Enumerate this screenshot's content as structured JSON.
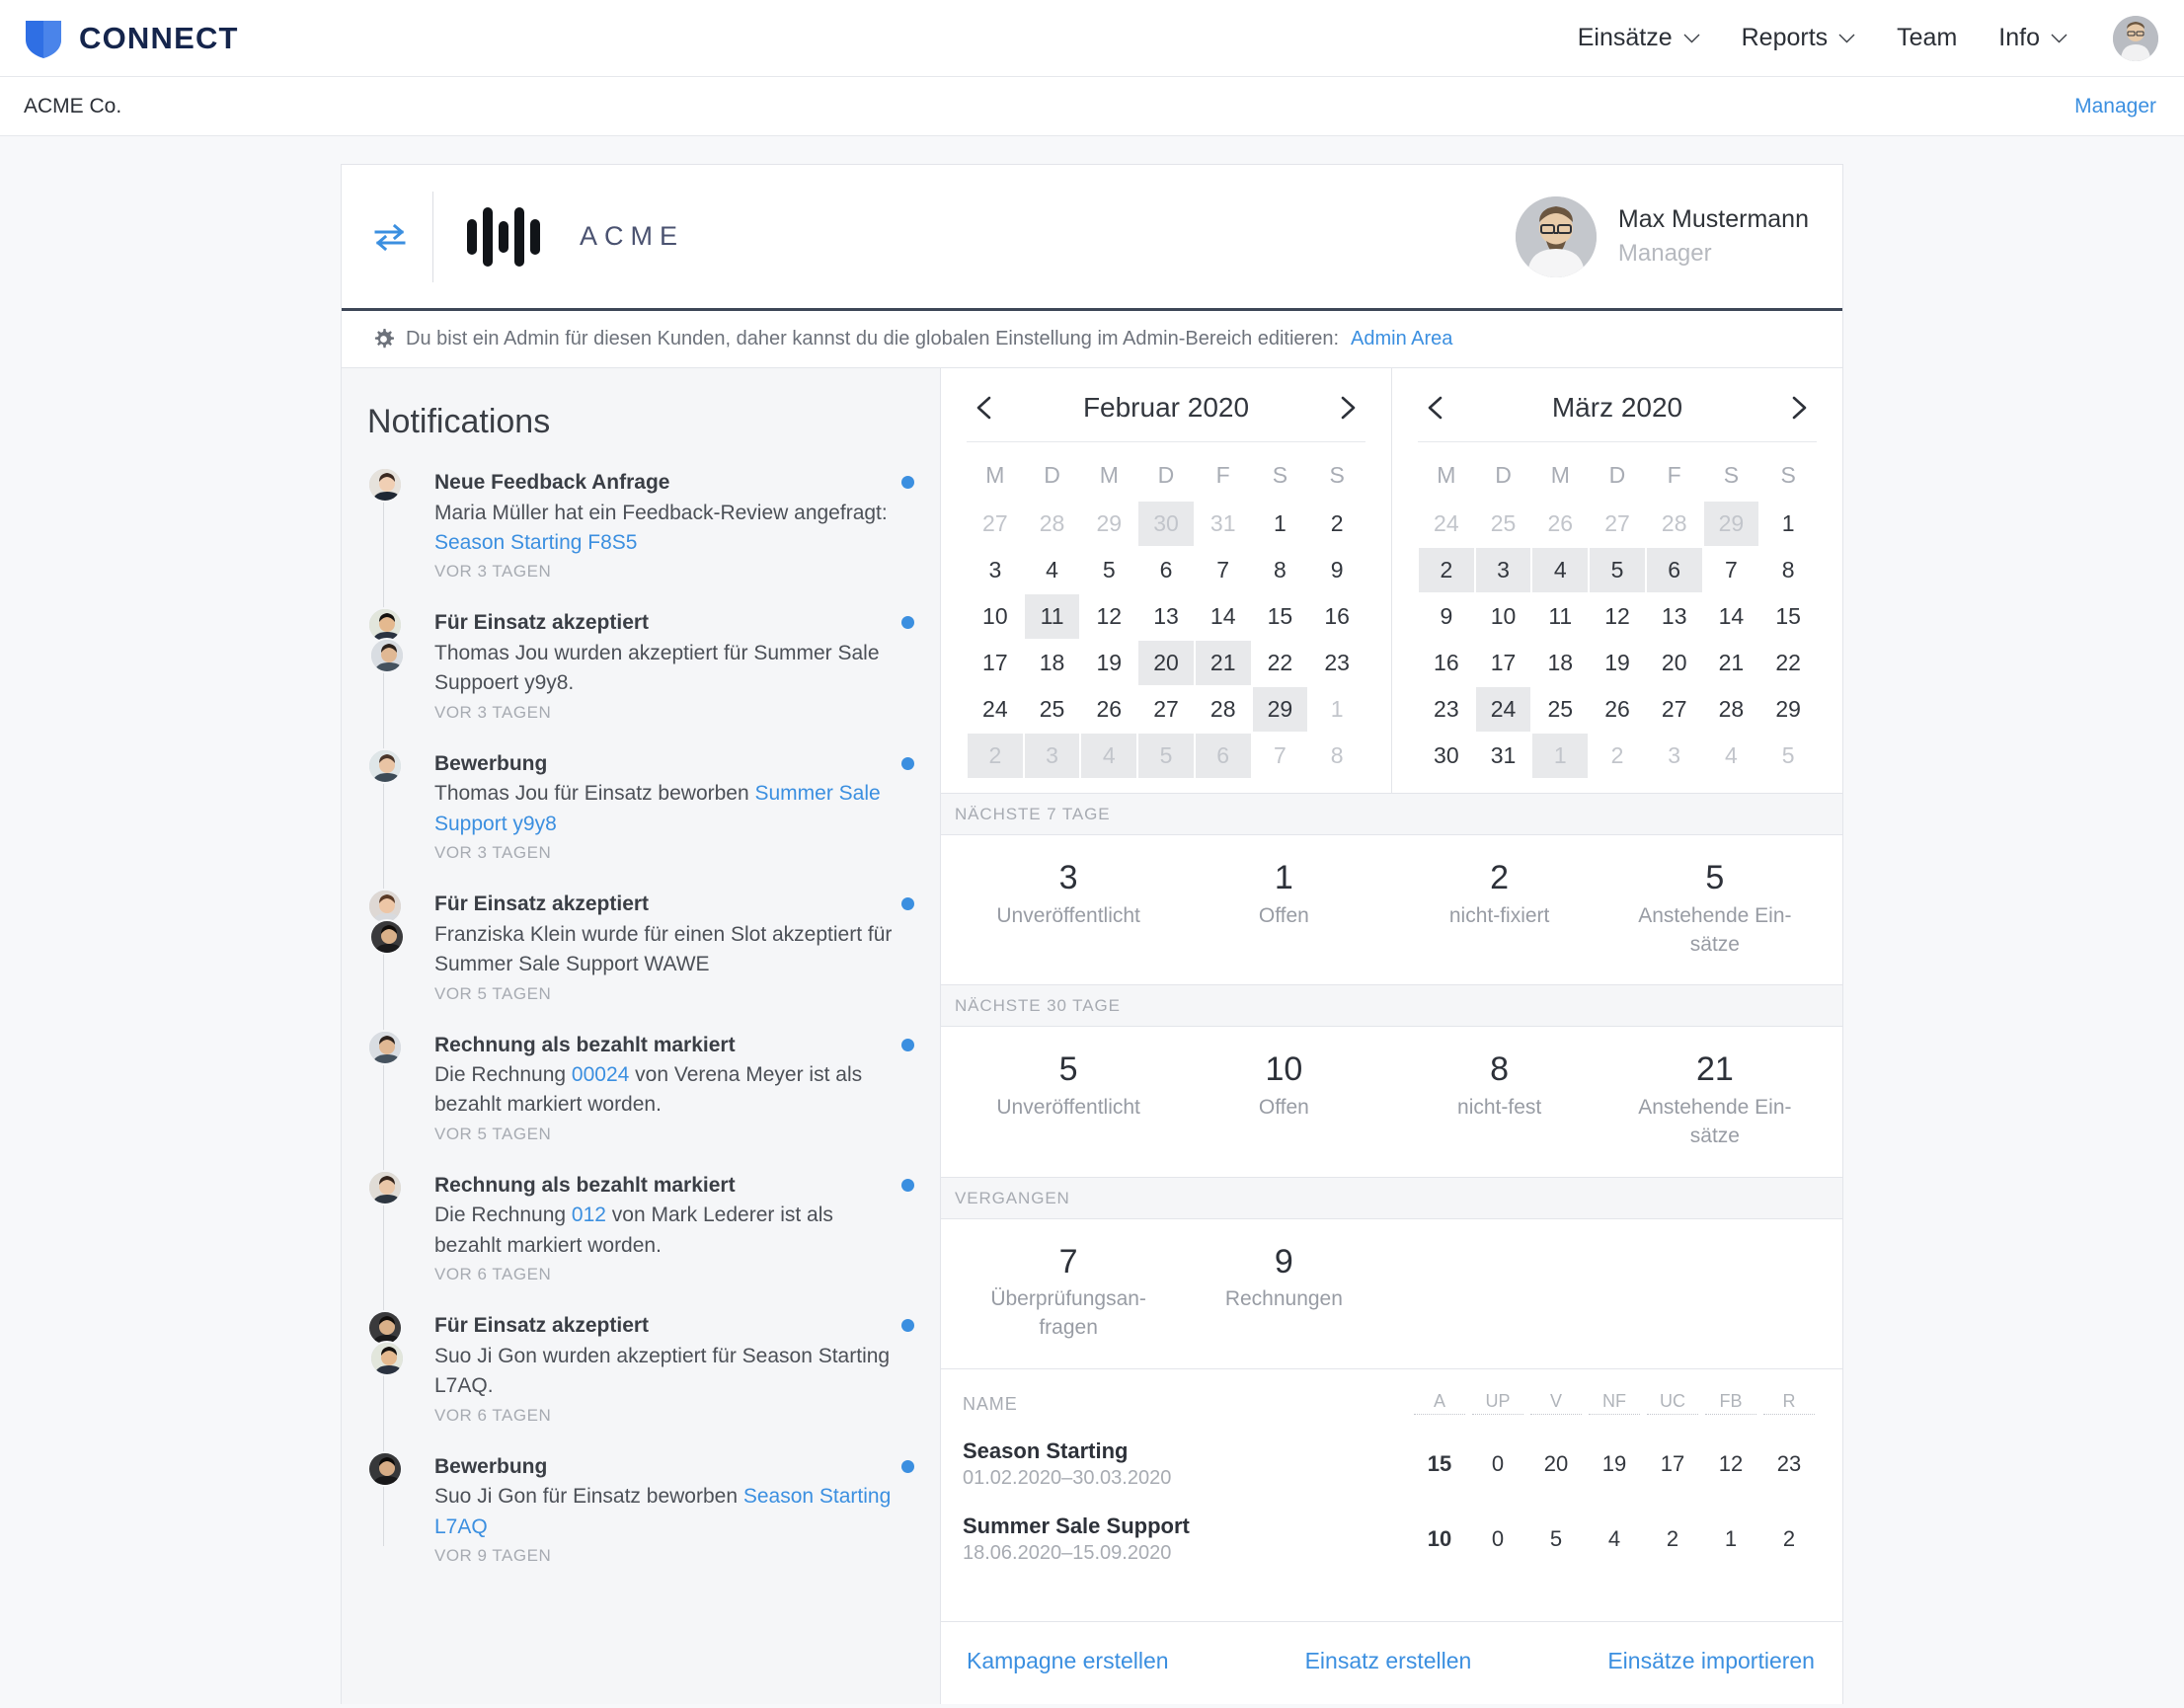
{
  "colors": {
    "accent": "#3b8fe0",
    "brand_navy": "#15254c",
    "shield": "#2f6fe4"
  },
  "topnav": {
    "brand": "CONNECT",
    "items": [
      {
        "label": "Einsätze",
        "has_caret": true
      },
      {
        "label": "Reports",
        "has_caret": true
      },
      {
        "label": "Team",
        "has_caret": false
      },
      {
        "label": "Info",
        "has_caret": true
      }
    ]
  },
  "subheader": {
    "customer": "ACME Co.",
    "role_link": "Manager"
  },
  "card_header": {
    "company": "ACME",
    "user_name": "Max Mustermann",
    "user_role": "Manager"
  },
  "admin_notice": {
    "text": "Du bist ein Admin für diesen Kunden, daher kannst du die globalen Einstellung im Admin-Bereich editieren:",
    "link": "Admin Area"
  },
  "notifications": {
    "title": "Notifications",
    "items": [
      {
        "title": "Neue Feedback Anfrage",
        "text_before": "Maria Müller hat ein Feedback-Review angefragt: ",
        "link": "Season Starting F8S5",
        "text_after": "",
        "time": "VOR 3 TAGEN",
        "avatars": 1,
        "unread": true
      },
      {
        "title": "Für Einsatz akzeptiert",
        "text_before": "Thomas Jou wurden akzeptiert für Summer Sale Suppoert y9y8.",
        "link": "",
        "text_after": "",
        "time": "VOR 3 TAGEN",
        "avatars": 2,
        "unread": true
      },
      {
        "title": "Bewerbung",
        "text_before": "Thomas Jou für Einsatz beworben ",
        "link": "Summer Sale Support y9y8",
        "text_after": "",
        "time": "VOR 3 TAGEN",
        "avatars": 1,
        "unread": true
      },
      {
        "title": "Für Einsatz akzeptiert",
        "text_before": "Franziska Klein wurde für einen Slot akzeptiert für Summer Sale Support WAWE",
        "link": "",
        "text_after": "",
        "time": "VOR 5 TAGEN",
        "avatars": 2,
        "unread": true
      },
      {
        "title": "Rechnung als bezahlt markiert",
        "text_before": "Die Rechnung ",
        "link": "00024",
        "text_after": " von Verena Meyer ist als bezahlt markiert worden.",
        "time": "VOR 5 TAGEN",
        "avatars": 1,
        "unread": true
      },
      {
        "title": "Rechnung als bezahlt markiert",
        "text_before": "Die Rechnung ",
        "link": "012",
        "text_after": " von Mark Lederer ist als bezahlt markiert worden.",
        "time": "VOR 6 TAGEN",
        "avatars": 1,
        "unread": true
      },
      {
        "title": "Für Einsatz akzeptiert",
        "text_before": "Suo Ji Gon wurden akzeptiert für Season Starting L7AQ.",
        "link": "",
        "text_after": "",
        "time": "VOR 6 TAGEN",
        "avatars": 2,
        "unread": true
      },
      {
        "title": "Bewerbung",
        "text_before": "Suo Ji Gon für Einsatz beworben ",
        "link": "Season Starting L7AQ",
        "text_after": "",
        "time": "VOR 9 TAGEN",
        "avatars": 1,
        "unread": true
      }
    ]
  },
  "calendars": [
    {
      "month_label": "Februar 2020",
      "dow": [
        "M",
        "D",
        "M",
        "D",
        "F",
        "S",
        "S"
      ],
      "days": [
        {
          "n": 27,
          "mute": true,
          "hl": false
        },
        {
          "n": 28,
          "mute": true,
          "hl": false
        },
        {
          "n": 29,
          "mute": true,
          "hl": false
        },
        {
          "n": 30,
          "mute": true,
          "hl": true
        },
        {
          "n": 31,
          "mute": true,
          "hl": false
        },
        {
          "n": 1,
          "mute": false,
          "hl": false
        },
        {
          "n": 2,
          "mute": false,
          "hl": false
        },
        {
          "n": 3,
          "mute": false,
          "hl": false
        },
        {
          "n": 4,
          "mute": false,
          "hl": false
        },
        {
          "n": 5,
          "mute": false,
          "hl": false
        },
        {
          "n": 6,
          "mute": false,
          "hl": false
        },
        {
          "n": 7,
          "mute": false,
          "hl": false
        },
        {
          "n": 8,
          "mute": false,
          "hl": false
        },
        {
          "n": 9,
          "mute": false,
          "hl": false
        },
        {
          "n": 10,
          "mute": false,
          "hl": false
        },
        {
          "n": 11,
          "mute": false,
          "hl": true
        },
        {
          "n": 12,
          "mute": false,
          "hl": false
        },
        {
          "n": 13,
          "mute": false,
          "hl": false
        },
        {
          "n": 14,
          "mute": false,
          "hl": false
        },
        {
          "n": 15,
          "mute": false,
          "hl": false
        },
        {
          "n": 16,
          "mute": false,
          "hl": false
        },
        {
          "n": 17,
          "mute": false,
          "hl": false
        },
        {
          "n": 18,
          "mute": false,
          "hl": false
        },
        {
          "n": 19,
          "mute": false,
          "hl": false
        },
        {
          "n": 20,
          "mute": false,
          "hl": true
        },
        {
          "n": 21,
          "mute": false,
          "hl": true
        },
        {
          "n": 22,
          "mute": false,
          "hl": false
        },
        {
          "n": 23,
          "mute": false,
          "hl": false
        },
        {
          "n": 24,
          "mute": false,
          "hl": false
        },
        {
          "n": 25,
          "mute": false,
          "hl": false
        },
        {
          "n": 26,
          "mute": false,
          "hl": false
        },
        {
          "n": 27,
          "mute": false,
          "hl": false
        },
        {
          "n": 28,
          "mute": false,
          "hl": false
        },
        {
          "n": 29,
          "mute": false,
          "hl": true
        },
        {
          "n": 1,
          "mute": true,
          "hl": false
        },
        {
          "n": 2,
          "mute": true,
          "hl": true
        },
        {
          "n": 3,
          "mute": true,
          "hl": true
        },
        {
          "n": 4,
          "mute": true,
          "hl": true
        },
        {
          "n": 5,
          "mute": true,
          "hl": true
        },
        {
          "n": 6,
          "mute": true,
          "hl": true
        },
        {
          "n": 7,
          "mute": true,
          "hl": false
        },
        {
          "n": 8,
          "mute": true,
          "hl": false
        }
      ]
    },
    {
      "month_label": "März 2020",
      "dow": [
        "M",
        "D",
        "M",
        "D",
        "F",
        "S",
        "S"
      ],
      "days": [
        {
          "n": 24,
          "mute": true,
          "hl": false
        },
        {
          "n": 25,
          "mute": true,
          "hl": false
        },
        {
          "n": 26,
          "mute": true,
          "hl": false
        },
        {
          "n": 27,
          "mute": true,
          "hl": false
        },
        {
          "n": 28,
          "mute": true,
          "hl": false
        },
        {
          "n": 29,
          "mute": true,
          "hl": true
        },
        {
          "n": 1,
          "mute": false,
          "hl": false
        },
        {
          "n": 2,
          "mute": false,
          "hl": true
        },
        {
          "n": 3,
          "mute": false,
          "hl": true
        },
        {
          "n": 4,
          "mute": false,
          "hl": true
        },
        {
          "n": 5,
          "mute": false,
          "hl": true
        },
        {
          "n": 6,
          "mute": false,
          "hl": true
        },
        {
          "n": 7,
          "mute": false,
          "hl": false
        },
        {
          "n": 8,
          "mute": false,
          "hl": false
        },
        {
          "n": 9,
          "mute": false,
          "hl": false
        },
        {
          "n": 10,
          "mute": false,
          "hl": false
        },
        {
          "n": 11,
          "mute": false,
          "hl": false
        },
        {
          "n": 12,
          "mute": false,
          "hl": false
        },
        {
          "n": 13,
          "mute": false,
          "hl": false
        },
        {
          "n": 14,
          "mute": false,
          "hl": false
        },
        {
          "n": 15,
          "mute": false,
          "hl": false
        },
        {
          "n": 16,
          "mute": false,
          "hl": false
        },
        {
          "n": 17,
          "mute": false,
          "hl": false
        },
        {
          "n": 18,
          "mute": false,
          "hl": false
        },
        {
          "n": 19,
          "mute": false,
          "hl": false
        },
        {
          "n": 20,
          "mute": false,
          "hl": false
        },
        {
          "n": 21,
          "mute": false,
          "hl": false
        },
        {
          "n": 22,
          "mute": false,
          "hl": false
        },
        {
          "n": 23,
          "mute": false,
          "hl": false
        },
        {
          "n": 24,
          "mute": false,
          "hl": true
        },
        {
          "n": 25,
          "mute": false,
          "hl": false
        },
        {
          "n": 26,
          "mute": false,
          "hl": false
        },
        {
          "n": 27,
          "mute": false,
          "hl": false
        },
        {
          "n": 28,
          "mute": false,
          "hl": false
        },
        {
          "n": 29,
          "mute": false,
          "hl": false
        },
        {
          "n": 30,
          "mute": false,
          "hl": false
        },
        {
          "n": 31,
          "mute": false,
          "hl": false
        },
        {
          "n": 1,
          "mute": true,
          "hl": true
        },
        {
          "n": 2,
          "mute": true,
          "hl": false
        },
        {
          "n": 3,
          "mute": true,
          "hl": false
        },
        {
          "n": 4,
          "mute": true,
          "hl": false
        },
        {
          "n": 5,
          "mute": true,
          "hl": false
        }
      ]
    }
  ],
  "stat_groups": [
    {
      "label": "NÄCHSTE 7 TAGE",
      "stats": [
        {
          "value": "3",
          "caption": "Unveröffentlicht"
        },
        {
          "value": "1",
          "caption": "Offen"
        },
        {
          "value": "2",
          "caption": "nicht-fixiert"
        },
        {
          "value": "5",
          "caption": "Anstehende Ein-sätze"
        }
      ]
    },
    {
      "label": "NÄCHSTE 30 TAGE",
      "stats": [
        {
          "value": "5",
          "caption": "Unveröffentlicht"
        },
        {
          "value": "10",
          "caption": "Offen"
        },
        {
          "value": "8",
          "caption": "nicht-fest"
        },
        {
          "value": "21",
          "caption": "Anstehende Ein-sätze"
        }
      ]
    },
    {
      "label": "VERGANGEN",
      "stats": [
        {
          "value": "7",
          "caption": "Überprüfungsan-fragen"
        },
        {
          "value": "9",
          "caption": "Rechnungen"
        },
        {
          "value": "",
          "caption": ""
        },
        {
          "value": "",
          "caption": ""
        }
      ]
    }
  ],
  "campaigns": {
    "name_header": "NAME",
    "metric_headers": [
      "A",
      "UP",
      "V",
      "NF",
      "UC",
      "FB",
      "R"
    ],
    "rows": [
      {
        "name": "Season Starting",
        "dates": "01.02.2020–30.03.2020",
        "values": [
          "15",
          "0",
          "20",
          "19",
          "17",
          "12",
          "23"
        ]
      },
      {
        "name": "Summer Sale Support",
        "dates": "18.06.2020–15.09.2020",
        "values": [
          "10",
          "0",
          "5",
          "4",
          "2",
          "1",
          "2"
        ]
      }
    ]
  },
  "actions": [
    {
      "label": "Kampagne erstellen"
    },
    {
      "label": "Einsatz erstellen"
    },
    {
      "label": "Einsätze importieren"
    }
  ]
}
